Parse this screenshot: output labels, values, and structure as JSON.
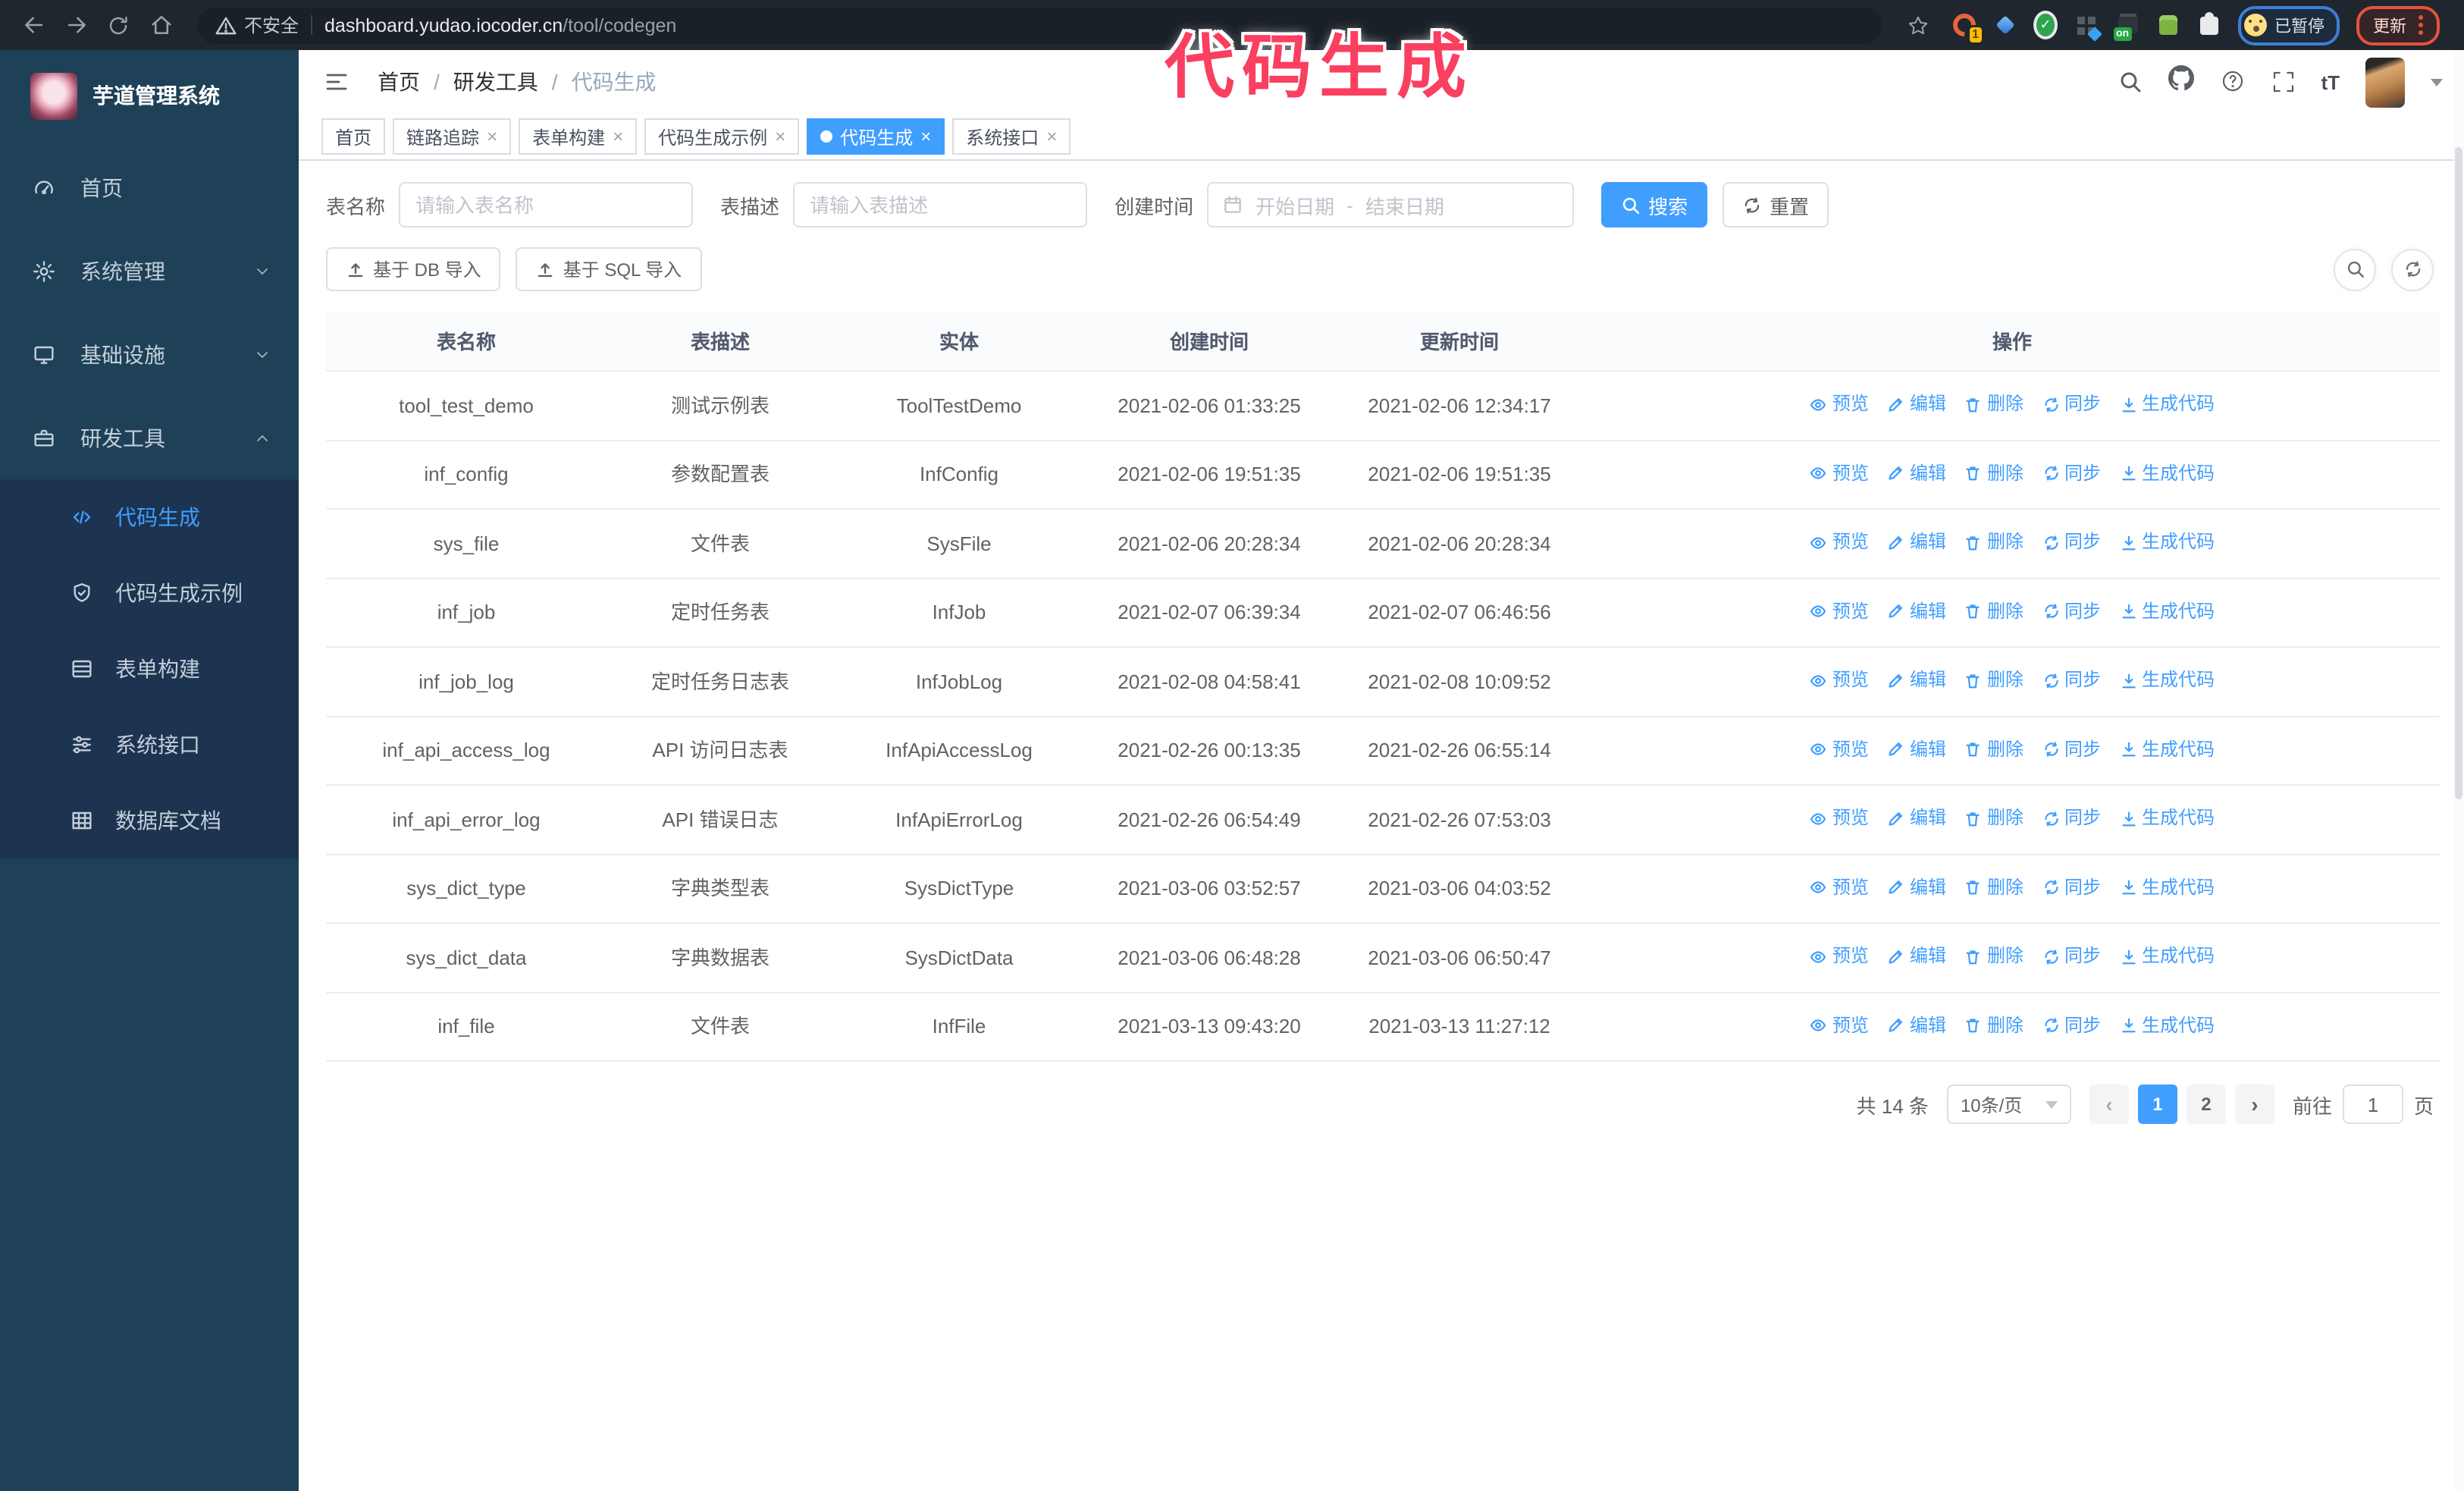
{
  "browser": {
    "security_label": "不安全",
    "url_host": "dashboard.yudao.iocoder.cn",
    "url_path": "/tool/codegen",
    "extension_count_badge": "1",
    "extension_on_badge": "on",
    "paused_badge": "已暂停",
    "update_button": "更新"
  },
  "watermark": {
    "text": "代码生成",
    "color": "#fa3f5f"
  },
  "sidebar": {
    "title": "芋道管理系统",
    "items": [
      {
        "label": "首页",
        "icon": "dashboard-icon"
      },
      {
        "label": "系统管理",
        "icon": "gear-icon"
      },
      {
        "label": "基础设施",
        "icon": "monitor-icon"
      },
      {
        "label": "研发工具",
        "icon": "toolbox-icon"
      }
    ],
    "submenu": [
      {
        "label": "代码生成",
        "icon": "code-icon",
        "active": true
      },
      {
        "label": "代码生成示例",
        "icon": "shield-check-icon",
        "active": false
      },
      {
        "label": "表单构建",
        "icon": "form-icon",
        "active": false
      },
      {
        "label": "系统接口",
        "icon": "sliders-icon",
        "active": false
      },
      {
        "label": "数据库文档",
        "icon": "table-grid-icon",
        "active": false
      }
    ]
  },
  "header": {
    "breadcrumb": [
      "首页",
      "研发工具",
      "代码生成"
    ],
    "separator": "/"
  },
  "tabs": [
    {
      "label": "首页",
      "closable": false,
      "active": false
    },
    {
      "label": "链路追踪",
      "closable": true,
      "active": false
    },
    {
      "label": "表单构建",
      "closable": true,
      "active": false
    },
    {
      "label": "代码生成示例",
      "closable": true,
      "active": false
    },
    {
      "label": "代码生成",
      "closable": true,
      "active": true
    },
    {
      "label": "系统接口",
      "closable": true,
      "active": false
    }
  ],
  "icons": {
    "tab_close_glyph": "×",
    "prev_glyph": "‹",
    "next_glyph": "›",
    "check_glyph": "✓"
  },
  "filters": {
    "table_name_label": "表名称",
    "table_name_placeholder": "请输入表名称",
    "table_desc_label": "表描述",
    "table_desc_placeholder": "请输入表描述",
    "create_time_label": "创建时间",
    "date_start_placeholder": "开始日期",
    "date_separator": "-",
    "date_end_placeholder": "结束日期",
    "search_label": "搜索",
    "reset_label": "重置"
  },
  "toolbar": {
    "import_db_label": "基于 DB 导入",
    "import_sql_label": "基于 SQL 导入"
  },
  "table": {
    "columns": [
      "表名称",
      "表描述",
      "实体",
      "创建时间",
      "更新时间",
      "操作"
    ],
    "actions": [
      "预览",
      "编辑",
      "删除",
      "同步",
      "生成代码"
    ],
    "rows": [
      {
        "name": "tool_test_demo",
        "desc": "测试示例表",
        "entity": "ToolTestDemo",
        "created": "2021-02-06 01:33:25",
        "updated": "2021-02-06 12:34:17"
      },
      {
        "name": "inf_config",
        "desc": "参数配置表",
        "entity": "InfConfig",
        "created": "2021-02-06 19:51:35",
        "updated": "2021-02-06 19:51:35"
      },
      {
        "name": "sys_file",
        "desc": "文件表",
        "entity": "SysFile",
        "created": "2021-02-06 20:28:34",
        "updated": "2021-02-06 20:28:34"
      },
      {
        "name": "inf_job",
        "desc": "定时任务表",
        "entity": "InfJob",
        "created": "2021-02-07 06:39:34",
        "updated": "2021-02-07 06:46:56"
      },
      {
        "name": "inf_job_log",
        "desc": "定时任务日志表",
        "entity": "InfJobLog",
        "created": "2021-02-08 04:58:41",
        "updated": "2021-02-08 10:09:52"
      },
      {
        "name": "inf_api_access_log",
        "desc": "API 访问日志表",
        "entity": "InfApiAccessLog",
        "created": "2021-02-26 00:13:35",
        "updated": "2021-02-26 06:55:14"
      },
      {
        "name": "inf_api_error_log",
        "desc": "API 错误日志",
        "entity": "InfApiErrorLog",
        "created": "2021-02-26 06:54:49",
        "updated": "2021-02-26 07:53:03"
      },
      {
        "name": "sys_dict_type",
        "desc": "字典类型表",
        "entity": "SysDictType",
        "created": "2021-03-06 03:52:57",
        "updated": "2021-03-06 04:03:52"
      },
      {
        "name": "sys_dict_data",
        "desc": "字典数据表",
        "entity": "SysDictData",
        "created": "2021-03-06 06:48:28",
        "updated": "2021-03-06 06:50:47"
      },
      {
        "name": "inf_file",
        "desc": "文件表",
        "entity": "InfFile",
        "created": "2021-03-13 09:43:20",
        "updated": "2021-03-13 11:27:12"
      }
    ]
  },
  "pagination": {
    "total": "共 14 条",
    "page_size": "10条/页",
    "pages": [
      "1",
      "2"
    ],
    "active_page": "1",
    "goto_label": "前往",
    "goto_value": "1",
    "goto_suffix": "页"
  },
  "colors": {
    "accent": "#409eff",
    "sidebar_bg": "#1f4158",
    "submenu_bg": "#1c3450",
    "watermark": "#fa3f5f",
    "browser_bar_bg": "#20262e",
    "update_button_border": "#e5533d",
    "paused_badge_border": "#3d7fd6"
  }
}
